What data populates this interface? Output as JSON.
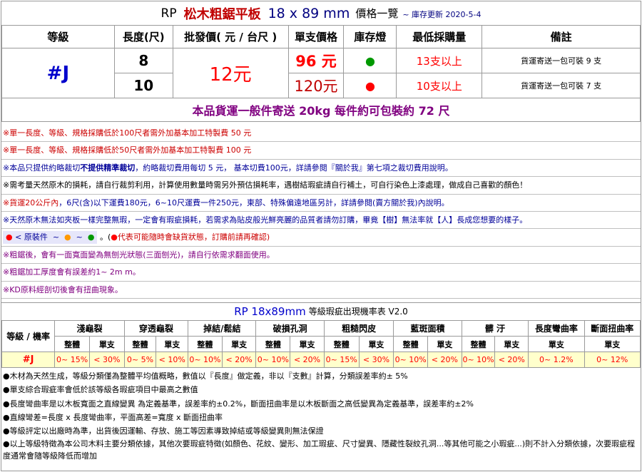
{
  "title": {
    "rp": "RP",
    "name": "松木粗鋸平板",
    "size": "18 x 89 mm",
    "list": "價格一覽",
    "stock_update": "~ 庫存更新 2020-5-4"
  },
  "price_table": {
    "headers": [
      "等級",
      "長度(尺)",
      "批發價( 元 / 台尺 )",
      "單支價格",
      "庫存燈",
      "最低採購量",
      "備註"
    ],
    "grade": "#J",
    "wholesale": "12元",
    "rows": [
      {
        "length": "8",
        "unit_price": "96 元",
        "stock_light": "●",
        "stock_color": "#009900",
        "min_order": "13支以上",
        "note": "貨運寄送一包可裝 9 支"
      },
      {
        "length": "10",
        "unit_price": "120元",
        "stock_light": "●",
        "stock_color": "#ff0000",
        "min_order": "10支以上",
        "note": "貨運寄送一包可裝 7 支"
      }
    ],
    "shipping": "本品貨運一般件寄送 20kg 每件約可包裝約 72 尺"
  },
  "notes": [
    "※單一長度、等級、規格採購低於100尺者需外加基本加工特製費 50 元",
    "※單一長度、等級、規格採購低於50尺者需外加基本加工特製費 100 元",
    {
      "a": "※本品只提供約略裁切",
      "b": "不提供精準裁切",
      "c": "，約略裁切費用每切 5 元， 基本切費100元，詳請參閱『關於我』第七項之裁切費用說明。"
    },
    "※需考量天然原木的損耗，請自行裁剪利用，計算使用數量時需另外預估損耗率，遇樹結瑕疵請自行補土，可自行染色上漆處理，做成自己喜歡的顏色！",
    {
      "a": "※貨運20公斤內",
      "b": "，6尺(含)以下運費180元，6~10尺運費一件250元，東部、特殊偏遠地區另計，詳請參閱(賣方關於我)內說明。"
    },
    "※天然原木無法如夾板一樣完整無瑕，一定會有瑕疵損耗，若需求為貼皮般光鮮亮麗的品質者請勿訂購，畢竟【樹】無法率就【人】長成您想要的樣子。",
    {
      "legend": "< 原裝件",
      "sep": "~",
      "tail": "代表可能隨時會缺貨狀態，訂購前請再確認)"
    },
    "※粗鋸後，會有一面寬面變為無刨光狀態(三面刨光)，請自行依需求翻面使用。",
    "※粗鋸加工厚度會有誤差約1~ 2m m。",
    "※KD原料經剖切後會有扭曲現象。"
  ],
  "defect_table": {
    "title": "RP 18x89mm",
    "title_b": "等級瑕疵出現機率表 V2.0",
    "grade_header": "等級 / 機率",
    "groups": [
      "淺龜裂",
      "穿透龜裂",
      "掉結/鬆結",
      "破損孔洞",
      "粗糙閃皮",
      "藍斑面積",
      "髒 汙",
      "長度彎曲率",
      "斷面扭曲率"
    ],
    "sub_whole": "整體",
    "sub_single": "單支",
    "grade": "#J",
    "values": [
      "0~ 15%",
      "< 30%",
      "0~ 5%",
      "< 10%",
      "0~ 10%",
      "< 20%",
      "0~ 10%",
      "< 20%",
      "0~ 15%",
      "< 30%",
      "0~ 10%",
      "< 20%",
      "0~ 10%",
      "< 20%",
      "0~ 1.2%",
      "0~ 12%"
    ]
  },
  "footnotes": [
    "●木材為天然生成，等級分類僅為整體平均值概略，數值以『長度』做定義，非以『支數』計算，分類誤差率約± 5%",
    "●單支綜合瑕疵率會低於該等級各瑕疵項目中最高之數值",
    "●長度彎曲率是以木板寬面之直線變異 為定義基準，誤差率約±0.2%，斷面扭曲率是以木板斷面之高低變異為定義基準，誤差率約±2%",
    "●直線彎差=長度 x 長度彎曲率，平面高差=寬度 x 斷面扭曲率",
    "●等級評定以出廠時為準，出貨後因運輸、存放、施工等因素導致掉結或等級變異則無法保證",
    "●以上等級特徵為本公司木料主要分類依據，其他次要瑕疵特徵(如顏色、花紋、變形、加工瑕疵、尺寸變異、隱藏性裂紋孔洞...等其他可能之小瑕疵...)則不計入分類依據，次要瑕疵程度通常會隨等級降低而增加"
  ]
}
